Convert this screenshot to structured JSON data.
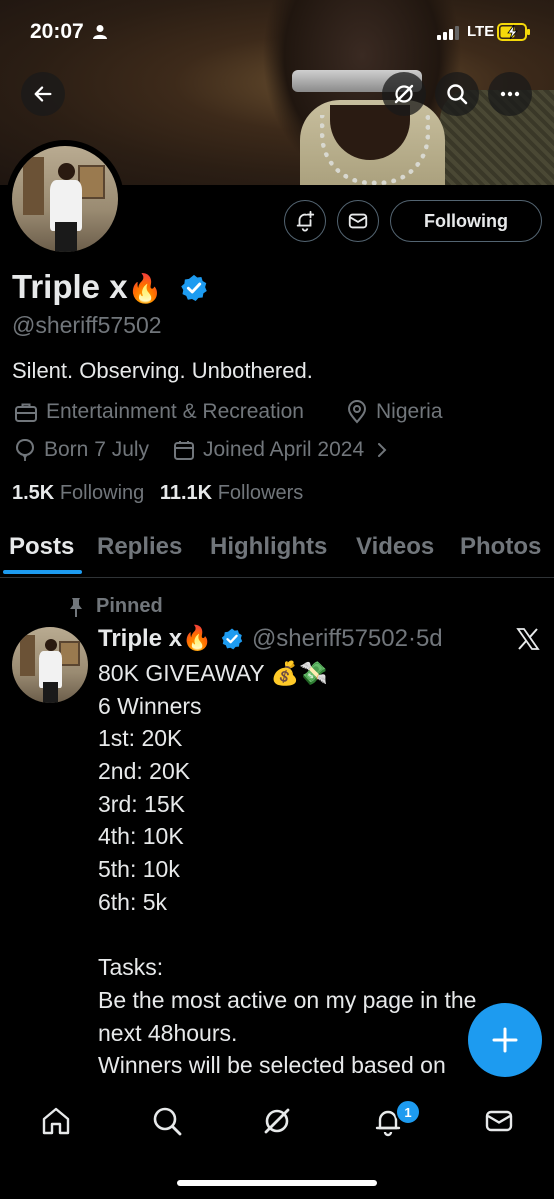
{
  "status_bar": {
    "time": "20:07",
    "network": "LTE"
  },
  "profile": {
    "name": "Triple x",
    "name_emoji": "🔥",
    "handle": "@sheriff57502",
    "bio": "Silent. Observing. Unbothered.",
    "category": "Entertainment & Recreation",
    "location": "Nigeria",
    "born": "Born 7 July",
    "joined": "Joined April 2024",
    "following_count": "1.5K",
    "following_label": "Following",
    "followers_count": "11.1K",
    "followers_label": "Followers",
    "follow_button": "Following"
  },
  "tabs": [
    "Posts",
    "Replies",
    "Highlights",
    "Videos",
    "Photos"
  ],
  "active_tab": "Posts",
  "pinned_post": {
    "pinned_label": "Pinned",
    "author": "Triple x",
    "author_emoji": "🔥",
    "handle": "@sheriff57502",
    "time": "·5d",
    "lines": [
      "80K GIVEAWAY 💰💸",
      "6 Winners",
      "1st: 20K",
      "2nd: 20K",
      "3rd: 15K",
      "4th: 10K",
      "5th: 10k",
      "6th: 5k",
      "",
      "Tasks:",
      "Be the most active on my page in the",
      "next 48hours.",
      "Winners will be selected based on"
    ]
  },
  "bottom_nav": {
    "items": [
      "home-icon",
      "search-icon",
      "grok-icon",
      "notifications-icon",
      "messages-icon"
    ],
    "notification_badge": "1"
  },
  "colors": {
    "accent": "#1d9bf0",
    "muted": "#71767b",
    "text": "#e7e9ea",
    "background": "#000000"
  }
}
